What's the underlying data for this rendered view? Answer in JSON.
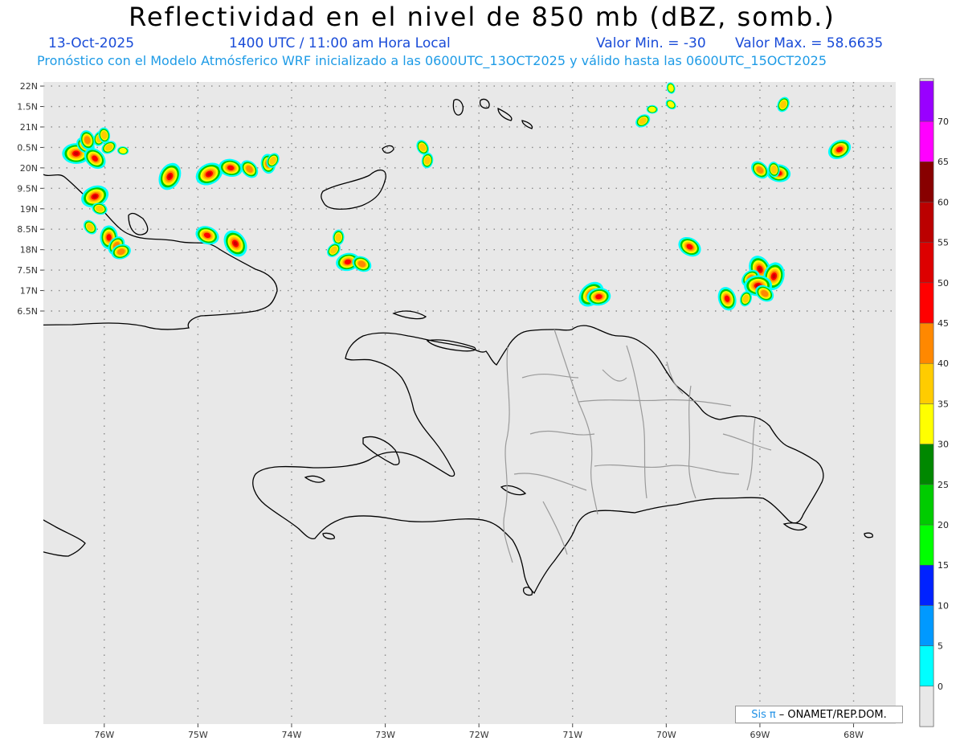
{
  "header": {
    "title": "Reflectividad en el nivel de 850 mb (dBZ, somb.)",
    "date": "13-Oct-2025",
    "time": "1400 UTC / 11:00 am Hora Local",
    "vmin": "Valor Min. = -30",
    "vmax": "Valor Max. = 58.6635",
    "forecast": "Pronóstico con el Modelo Atmósferico WRF inicializado a las 0600UTC_13OCT2025 y válido hasta las  0600UTC_15OCT2025"
  },
  "map": {
    "lon_range": [
      -76.65,
      -67.55
    ],
    "lat_range": [
      6.4,
      22.1
    ],
    "lon_ticks": [
      {
        "v": -76,
        "label": "76W"
      },
      {
        "v": -75,
        "label": "75W"
      },
      {
        "v": -74,
        "label": "74W"
      },
      {
        "v": -73,
        "label": "73W"
      },
      {
        "v": -72,
        "label": "72W"
      },
      {
        "v": -71,
        "label": "71W"
      },
      {
        "v": -70,
        "label": "70W"
      },
      {
        "v": -69,
        "label": "69W"
      },
      {
        "v": -68,
        "label": "68W"
      }
    ],
    "lat_ticks": [
      {
        "v": 22,
        "label": "22N"
      },
      {
        "v": 21.5,
        "label": "1.5N"
      },
      {
        "v": 21,
        "label": "21N"
      },
      {
        "v": 20.5,
        "label": "0.5N"
      },
      {
        "v": 20,
        "label": "20N"
      },
      {
        "v": 19.5,
        "label": "9.5N"
      },
      {
        "v": 19,
        "label": "19N"
      },
      {
        "v": 18.5,
        "label": "8.5N"
      },
      {
        "v": 18,
        "label": "18N"
      },
      {
        "v": 17.5,
        "label": "7.5N"
      },
      {
        "v": 17,
        "label": "17N"
      },
      {
        "v": 16.5,
        "label": "6.5N"
      }
    ],
    "background_color": "#e8e8e8",
    "grid": true
  },
  "colorbar": {
    "labels": [
      "0",
      "5",
      "10",
      "15",
      "20",
      "25",
      "30",
      "35",
      "40",
      "45",
      "50",
      "55",
      "60",
      "65",
      "70"
    ],
    "colors": [
      "#e8e8e8",
      "#00ffff",
      "#0099ff",
      "#0022ff",
      "#00ff00",
      "#00cc00",
      "#008800",
      "#ffff00",
      "#ffcc00",
      "#ff8800",
      "#ff0000",
      "#dd0000",
      "#bb0000",
      "#880000",
      "#ff00ff",
      "#9900ff"
    ]
  },
  "cells": [
    {
      "lon": -76.3,
      "lat": 20.35,
      "max": 50
    },
    {
      "lon": -76.2,
      "lat": 20.55,
      "max": 40
    },
    {
      "lon": -76.18,
      "lat": 20.68,
      "max": 40
    },
    {
      "lon": -76.05,
      "lat": 20.72,
      "max": 35
    },
    {
      "lon": -75.95,
      "lat": 20.5,
      "max": 35
    },
    {
      "lon": -75.8,
      "lat": 20.42,
      "max": 30
    },
    {
      "lon": -76.1,
      "lat": 20.23,
      "max": 45
    },
    {
      "lon": -76.0,
      "lat": 20.8,
      "max": 35
    },
    {
      "lon": -75.3,
      "lat": 19.79,
      "max": 50
    },
    {
      "lon": -74.88,
      "lat": 19.85,
      "max": 50
    },
    {
      "lon": -74.65,
      "lat": 20.0,
      "max": 45
    },
    {
      "lon": -74.45,
      "lat": 19.97,
      "max": 40
    },
    {
      "lon": -74.25,
      "lat": 20.1,
      "max": 40
    },
    {
      "lon": -74.2,
      "lat": 20.18,
      "max": 35
    },
    {
      "lon": -76.1,
      "lat": 19.3,
      "max": 50
    },
    {
      "lon": -76.05,
      "lat": 19.0,
      "max": 35
    },
    {
      "lon": -76.15,
      "lat": 18.55,
      "max": 35
    },
    {
      "lon": -75.95,
      "lat": 18.3,
      "max": 45
    },
    {
      "lon": -75.87,
      "lat": 18.1,
      "max": 40
    },
    {
      "lon": -75.82,
      "lat": 17.95,
      "max": 40
    },
    {
      "lon": -74.9,
      "lat": 18.35,
      "max": 45
    },
    {
      "lon": -74.6,
      "lat": 18.15,
      "max": 50
    },
    {
      "lon": -73.5,
      "lat": 18.3,
      "max": 35
    },
    {
      "lon": -73.55,
      "lat": 17.99,
      "max": 35
    },
    {
      "lon": -73.4,
      "lat": 17.7,
      "max": 45
    },
    {
      "lon": -73.25,
      "lat": 17.65,
      "max": 40
    },
    {
      "lon": -72.6,
      "lat": 20.5,
      "max": 35
    },
    {
      "lon": -72.55,
      "lat": 20.18,
      "max": 35
    },
    {
      "lon": -70.8,
      "lat": 16.91,
      "max": 50
    },
    {
      "lon": -70.72,
      "lat": 16.85,
      "max": 45
    },
    {
      "lon": -69.75,
      "lat": 18.07,
      "max": 45
    },
    {
      "lon": -69.0,
      "lat": 17.52,
      "max": 50
    },
    {
      "lon": -68.85,
      "lat": 17.35,
      "max": 50
    },
    {
      "lon": -69.1,
      "lat": 17.3,
      "max": 40
    },
    {
      "lon": -69.02,
      "lat": 17.12,
      "max": 50
    },
    {
      "lon": -68.95,
      "lat": 16.93,
      "max": 40
    },
    {
      "lon": -69.35,
      "lat": 16.8,
      "max": 45
    },
    {
      "lon": -69.15,
      "lat": 16.8,
      "max": 35
    },
    {
      "lon": -70.25,
      "lat": 21.15,
      "max": 35
    },
    {
      "lon": -70.15,
      "lat": 21.43,
      "max": 30
    },
    {
      "lon": -69.95,
      "lat": 21.55,
      "max": 30
    },
    {
      "lon": -69.95,
      "lat": 21.95,
      "max": 30
    },
    {
      "lon": -68.75,
      "lat": 21.55,
      "max": 35
    },
    {
      "lon": -68.15,
      "lat": 20.45,
      "max": 45
    },
    {
      "lon": -68.8,
      "lat": 19.87,
      "max": 45
    },
    {
      "lon": -69.0,
      "lat": 19.95,
      "max": 40
    },
    {
      "lon": -68.85,
      "lat": 19.96,
      "max": 35
    }
  ],
  "credit": {
    "logo": "Sis",
    "pi": "π",
    "text": "– ONAMET/REP.DOM."
  }
}
